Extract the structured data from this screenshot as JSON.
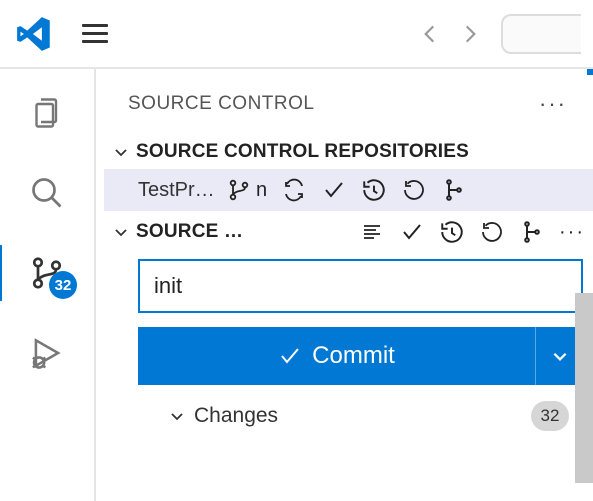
{
  "titlebar": {},
  "activitybar": {
    "scm_badge": "32"
  },
  "panel": {
    "title": "SOURCE CONTROL",
    "sections": {
      "repositories": {
        "title": "SOURCE CONTROL REPOSITORIES",
        "repo_name": "TestPr…",
        "branch_label": "n"
      },
      "source_control": {
        "title": "SOURCE …",
        "commit_message": "init",
        "commit_button": "Commit",
        "changes": {
          "label": "Changes",
          "count": "32"
        }
      }
    }
  }
}
